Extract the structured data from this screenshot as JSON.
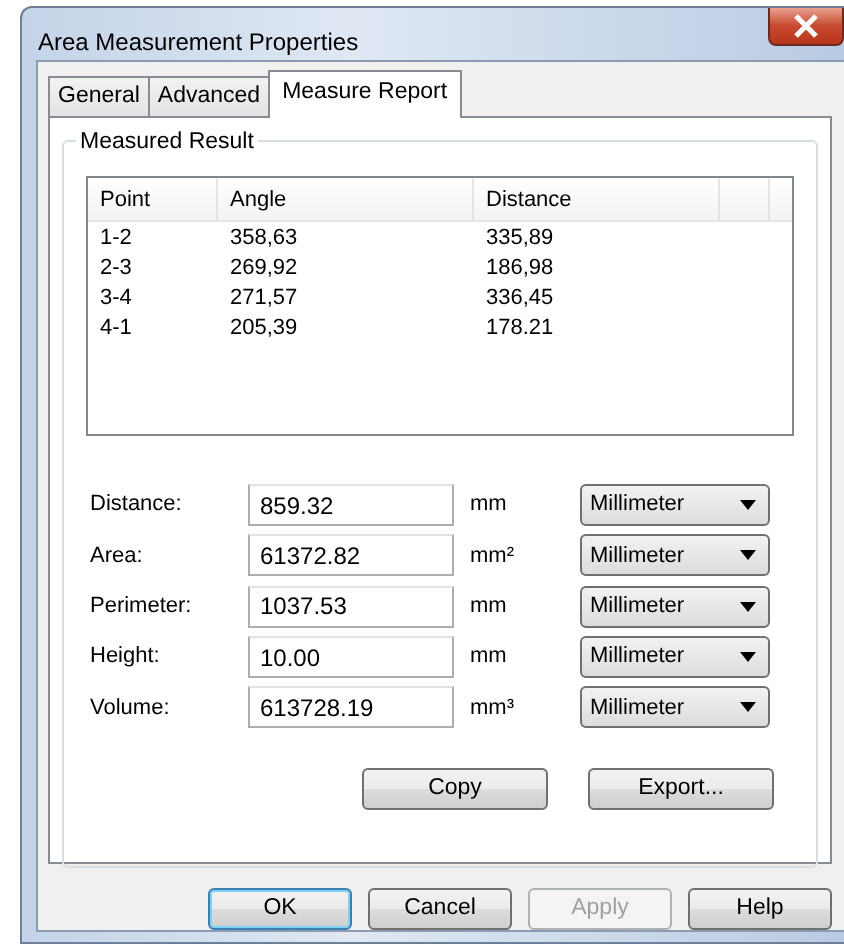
{
  "window": {
    "title": "Area Measurement Properties"
  },
  "tabs": [
    {
      "label": "General",
      "selected": false
    },
    {
      "label": "Advanced",
      "selected": false
    },
    {
      "label": "Measure Report",
      "selected": true
    }
  ],
  "group": {
    "title": "Measured Result"
  },
  "table": {
    "columns": [
      "Point",
      "Angle",
      "Distance"
    ],
    "rows": [
      [
        "1-2",
        "358,63",
        "335,89"
      ],
      [
        "2-3",
        "269,92",
        "186,98"
      ],
      [
        "3-4",
        "271,57",
        "336,45"
      ],
      [
        "4-1",
        "205,39",
        "178.21"
      ]
    ]
  },
  "fields": [
    {
      "label": "Distance:",
      "value": "859.32",
      "unit": "mm",
      "dropdown": "Millimeter"
    },
    {
      "label": "Area:",
      "value": "61372.82",
      "unit": "mm²",
      "dropdown": "Millimeter"
    },
    {
      "label": "Perimeter:",
      "value": "1037.53",
      "unit": "mm",
      "dropdown": "Millimeter"
    },
    {
      "label": "Height:",
      "value": "10.00",
      "unit": "mm",
      "dropdown": "Millimeter"
    },
    {
      "label": "Volume:",
      "value": "613728.19",
      "unit": "mm³",
      "dropdown": "Millimeter"
    }
  ],
  "group_buttons": [
    {
      "label": "Copy",
      "disabled": false
    },
    {
      "label": "Export...",
      "disabled": false
    }
  ],
  "buttons": [
    {
      "label": "OK",
      "disabled": false,
      "default": true
    },
    {
      "label": "Cancel",
      "disabled": false,
      "default": false
    },
    {
      "label": "Apply",
      "disabled": true,
      "default": false
    },
    {
      "label": "Help",
      "disabled": false,
      "default": false
    }
  ]
}
